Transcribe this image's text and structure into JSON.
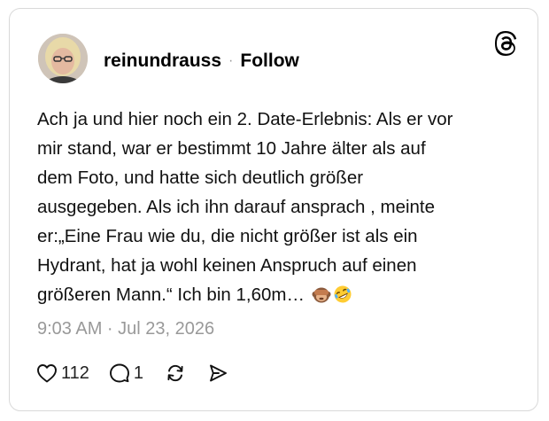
{
  "post": {
    "author": {
      "username": "reinundrauss",
      "separator": "·",
      "follow_label": "Follow"
    },
    "text_lines": [
      "Ach ja und hier noch ein 2. Date-Erlebnis: Als er vor",
      "mir stand, war er bestimmt 10 Jahre älter als auf",
      "dem Foto, und hatte sich deutlich größer",
      "ausgegeben. Als ich ihn darauf ansprach , meinte",
      "er:„Eine Frau wie du, die nicht größer ist als ein",
      "Hydrant, hat ja wohl keinen Anspruch auf einen",
      "größeren Mann.“ Ich bin 1,60m…"
    ],
    "emojis": [
      "see-no-evil-monkey-icon",
      "rolling-on-floor-laughing-icon"
    ],
    "timestamp": "9:03 AM · Jul 23, 2026",
    "actions": {
      "likes": "112",
      "replies": "1"
    }
  },
  "icons": {
    "brand": "threads-logo-icon",
    "like": "heart-icon",
    "reply": "comment-bubble-icon",
    "repost": "repost-icon",
    "share": "share-send-icon"
  },
  "colors": {
    "text": "#111111",
    "muted": "#999999",
    "border": "#d9d9d9"
  }
}
